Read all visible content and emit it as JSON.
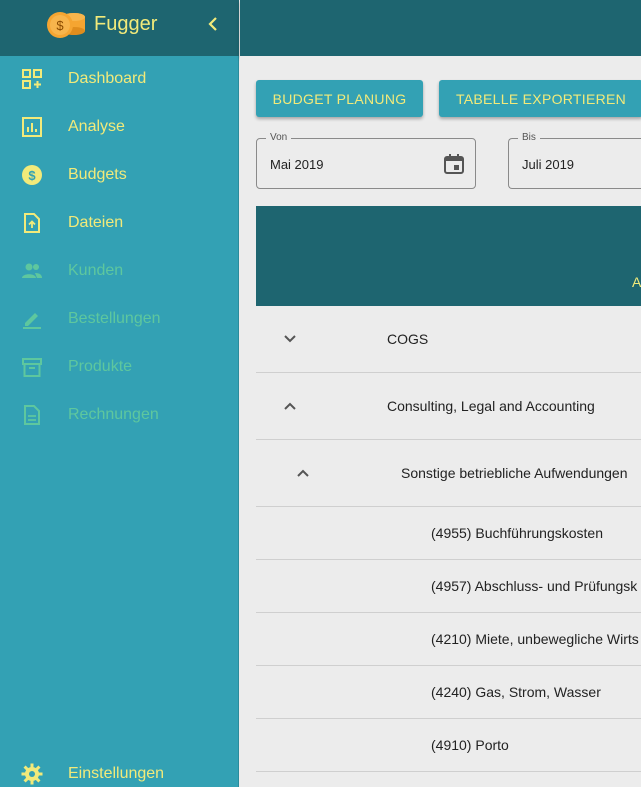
{
  "brand": {
    "name": "Fugger",
    "logo_icon": "coins-icon",
    "collapse_icon": "chevron-left-icon"
  },
  "nav": {
    "items": [
      {
        "label": "Dashboard",
        "icon": "dashboard-icon",
        "enabled": true
      },
      {
        "label": "Analyse",
        "icon": "analytics-icon",
        "enabled": true
      },
      {
        "label": "Budgets",
        "icon": "dollar-icon",
        "enabled": true
      },
      {
        "label": "Dateien",
        "icon": "file-upload-icon",
        "enabled": true
      },
      {
        "label": "Kunden",
        "icon": "people-icon",
        "enabled": false
      },
      {
        "label": "Bestellungen",
        "icon": "pen-icon",
        "enabled": false
      },
      {
        "label": "Produkte",
        "icon": "archive-icon",
        "enabled": false
      },
      {
        "label": "Rechnungen",
        "icon": "document-icon",
        "enabled": false
      }
    ],
    "settings_label": "Einstellungen"
  },
  "toolbar": {
    "budget_label": "Budget Planung",
    "export_label": "Tabelle exportieren"
  },
  "filters": {
    "from": {
      "legend": "Von",
      "value": "Mai 2019"
    },
    "to": {
      "legend": "Bis",
      "value": "Juli 2019"
    }
  },
  "table": {
    "header_fragment": "A",
    "rows": [
      {
        "label": "COGS",
        "expanded": false
      },
      {
        "label": "Consulting, Legal and Accounting",
        "expanded": true
      },
      {
        "label": "Sonstige betriebliche Aufwendungen",
        "expanded": true
      },
      {
        "label": "(4955) Buchführungskosten"
      },
      {
        "label": "(4957) Abschluss- und Prüfungsk"
      },
      {
        "label": "(4210) Miete, unbewegliche Wirts"
      },
      {
        "label": "(4240) Gas, Strom, Wasser"
      },
      {
        "label": "(4910) Porto"
      }
    ]
  },
  "colors": {
    "primary_dark": "#1e6570",
    "primary": "#33a1b4",
    "accent_yellow": "#f2ea7a",
    "disabled_green": "#5ec79e",
    "coin_orange": "#f5a531"
  }
}
